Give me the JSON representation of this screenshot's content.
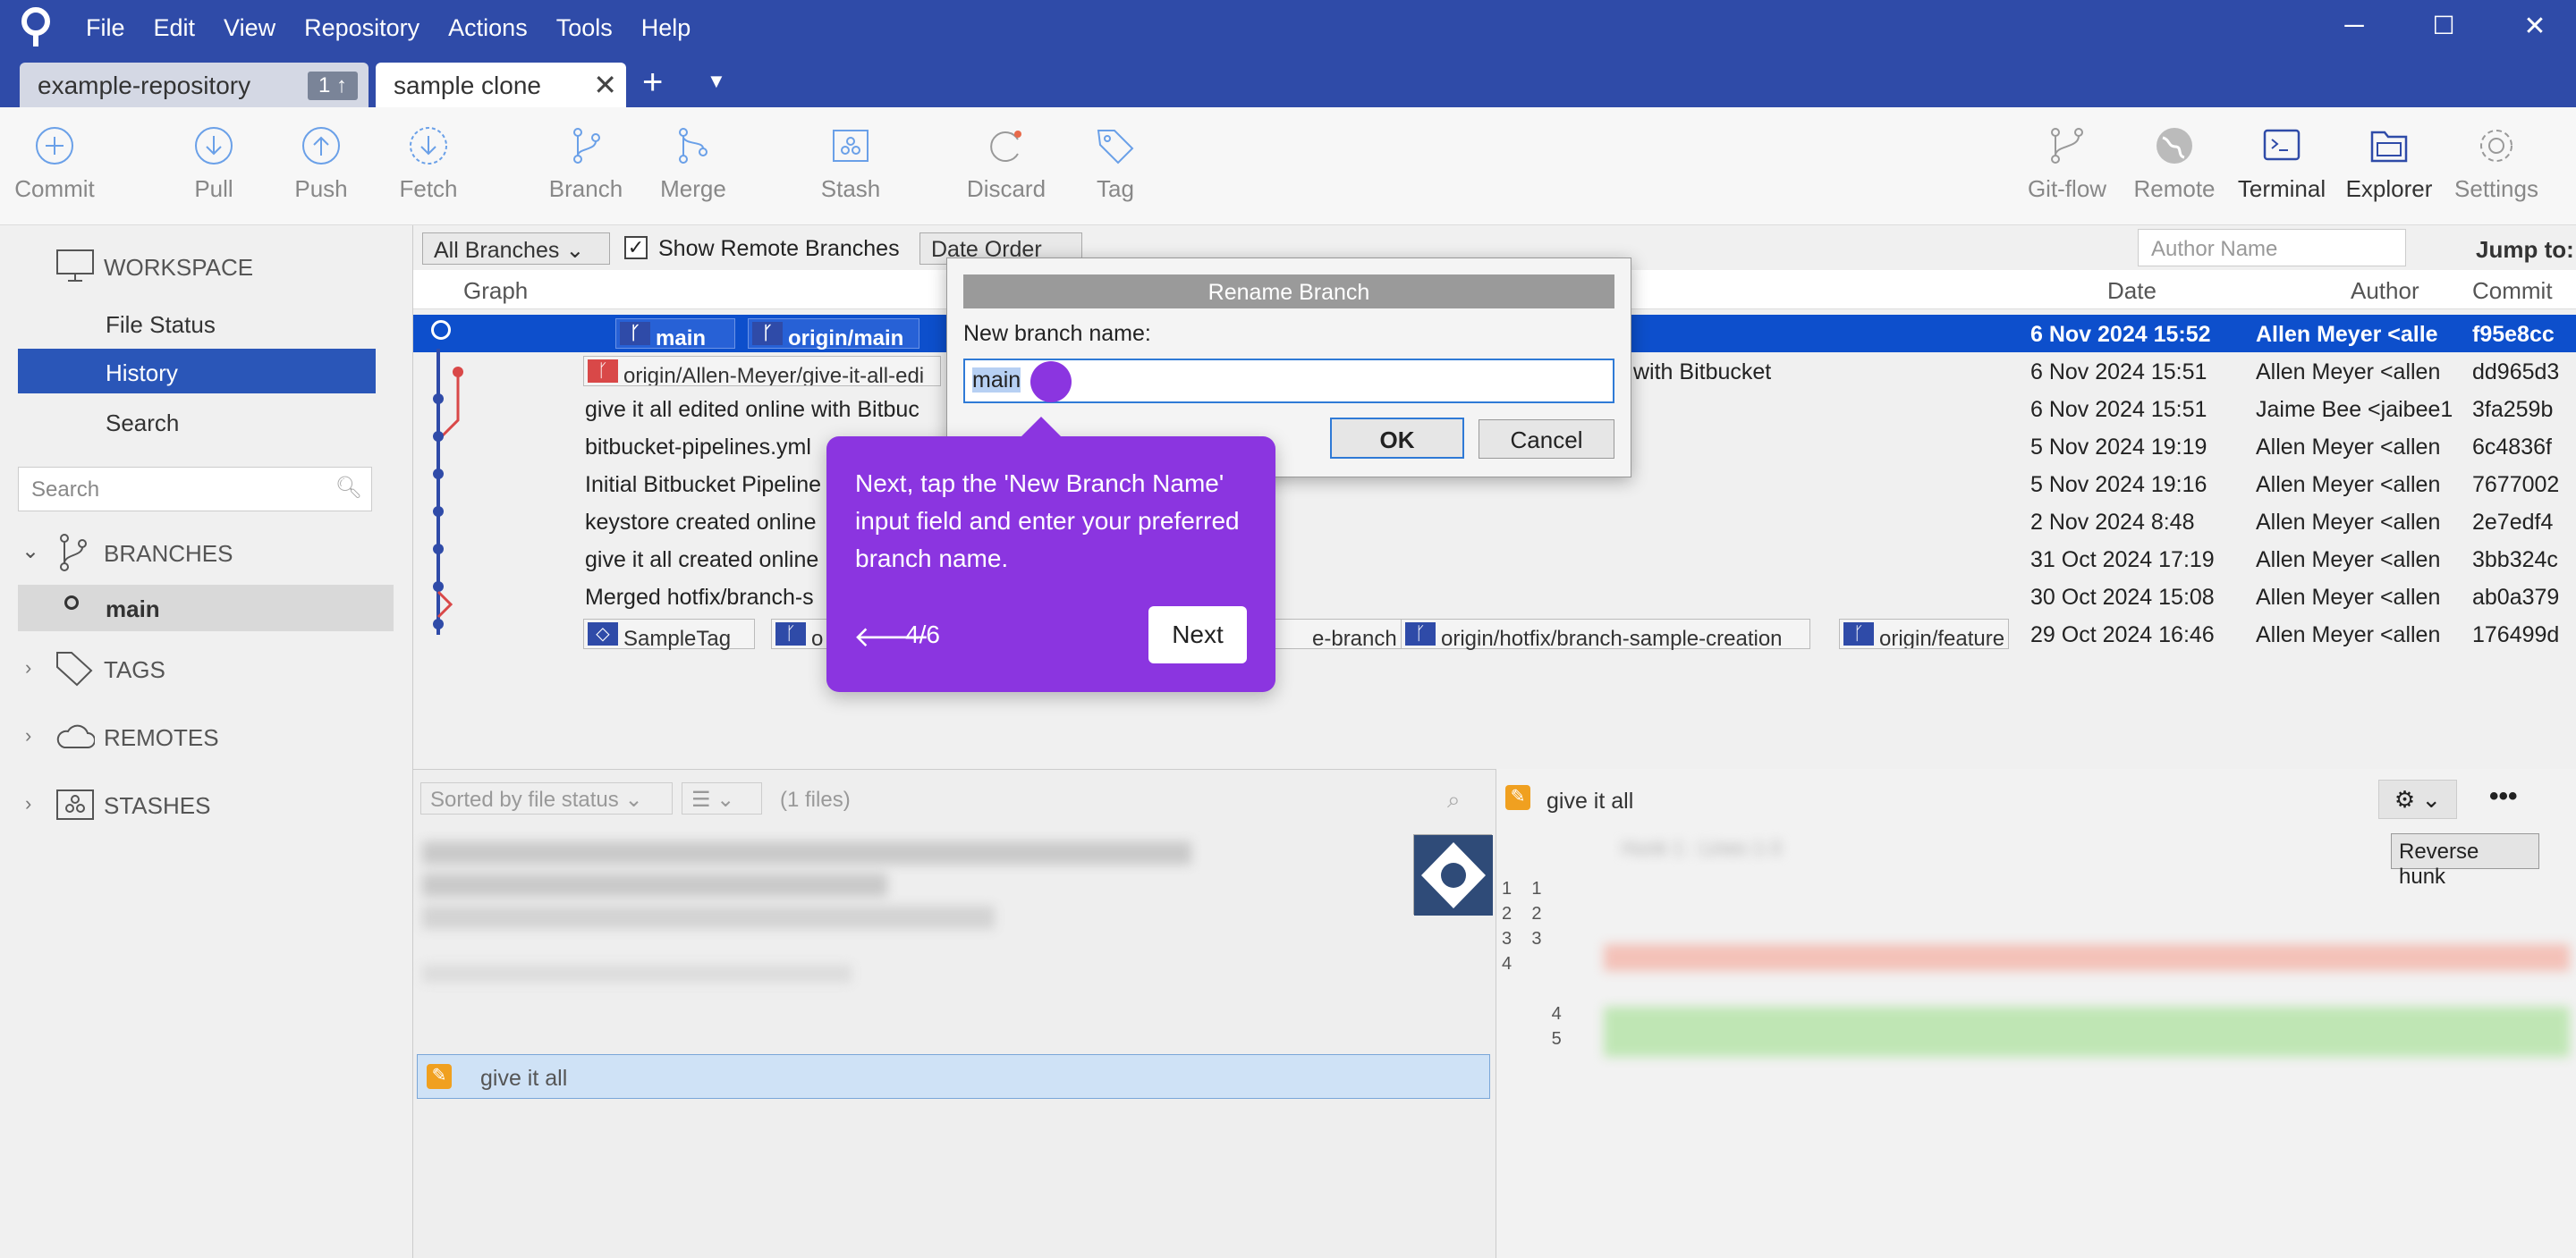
{
  "menu": [
    "File",
    "Edit",
    "View",
    "Repository",
    "Actions",
    "Tools",
    "Help"
  ],
  "tabs": {
    "tab1": "example-repository",
    "tab1_badge": "1 ↑",
    "tab2": "sample clone"
  },
  "toolbar": {
    "commit": "Commit",
    "pull": "Pull",
    "push": "Push",
    "fetch": "Fetch",
    "branch": "Branch",
    "merge": "Merge",
    "stash": "Stash",
    "discard": "Discard",
    "tag": "Tag",
    "gitflow": "Git-flow",
    "remote": "Remote",
    "terminal": "Terminal",
    "explorer": "Explorer",
    "settings": "Settings"
  },
  "sidebar": {
    "workspace": "WORKSPACE",
    "file_status": "File Status",
    "history": "History",
    "search_item": "Search",
    "search_placeholder": "Search",
    "branches": "BRANCHES",
    "branch_main": "main",
    "tags": "TAGS",
    "remotes": "REMOTES",
    "stashes": "STASHES"
  },
  "filters": {
    "branches": "All Branches",
    "show_remote": "Show Remote Branches",
    "order": "Date Order",
    "author_placeholder": "Author Name",
    "jump": "Jump to:"
  },
  "columns": {
    "graph": "Graph",
    "date": "Date",
    "author": "Author",
    "commit": "Commit"
  },
  "commits": [
    {
      "desc": "main",
      "date": "6 Nov 2024 15:52",
      "author": "Allen Meyer <alle",
      "hash": "f95e8cc"
    },
    {
      "desc": "origin/Allen-Meyer/give-it-all-edi",
      "extra": "with Bitbucket",
      "date": "6 Nov 2024 15:51",
      "author": "Allen Meyer <allen",
      "hash": "dd965d3"
    },
    {
      "desc": "give it all edited online with Bitbuc",
      "date": "6 Nov 2024 15:51",
      "author": "Jaime Bee <jaibee1",
      "hash": "3fa259b"
    },
    {
      "desc": "bitbucket-pipelines.yml",
      "date": "5 Nov 2024 19:19",
      "author": "Allen Meyer <allen",
      "hash": "6c4836f"
    },
    {
      "desc": "Initial Bitbucket Pipeline",
      "date": "5 Nov 2024 19:16",
      "author": "Allen Meyer <allen",
      "hash": "7677002"
    },
    {
      "desc": "keystore created online",
      "date": "2 Nov 2024 8:48",
      "author": "Allen Meyer <allen",
      "hash": "2e7edf4"
    },
    {
      "desc": "give it all created online",
      "date": "31 Oct 2024 17:19",
      "author": "Allen Meyer <allen",
      "hash": "3bb324c"
    },
    {
      "desc": "Merged hotfix/branch-s",
      "date": "30 Oct 2024 15:08",
      "author": "Allen Meyer <allen",
      "hash": "ab0a379"
    },
    {
      "desc": "",
      "date": "29 Oct 2024 16:46",
      "author": "Allen Meyer <allen",
      "hash": "176499d"
    }
  ],
  "row1_tags": {
    "main": "main",
    "origin_main": "origin/main"
  },
  "row9_tags": {
    "sampletag": "SampleTag",
    "o": "o",
    "e_branch": "e-branch",
    "hotfix": "origin/hotfix/branch-sample-creation",
    "feature": "origin/feature"
  },
  "lower": {
    "sorted": "Sorted by file status",
    "files": "(1 files)",
    "file_name": "give it all",
    "right_file": "give it all",
    "reverse_hunk": "Reverse hunk",
    "hunk": "Hunk 1 : Lines 1-3"
  },
  "dialog": {
    "title": "Rename Branch",
    "label": "New branch name:",
    "value": "main",
    "ok": "OK",
    "cancel": "Cancel"
  },
  "tooltip": {
    "text": "Next, tap the 'New Branch Name' input field and enter your preferred branch name.",
    "step": "4/6",
    "back": "🡐",
    "next": "Next"
  },
  "colors": {
    "titlebar": "#2f4ba8",
    "accent": "#8b35e0",
    "selection": "#0d4fcc"
  }
}
